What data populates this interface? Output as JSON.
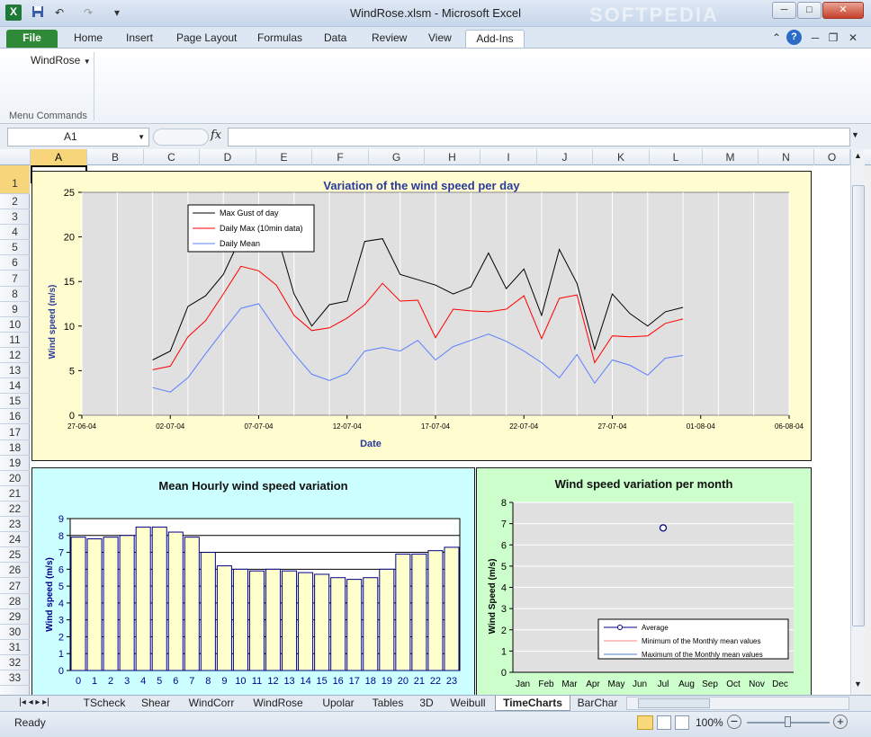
{
  "window": {
    "title": "WindRose.xlsm  -  Microsoft Excel",
    "watermark": "SOFTPEDIA",
    "buttons": {
      "minimize": "─",
      "maximize": "□",
      "close": "✕"
    }
  },
  "ribbon": {
    "tabs": [
      "File",
      "Home",
      "Insert",
      "Page Layout",
      "Formulas",
      "Data",
      "Review",
      "View",
      "Add-Ins"
    ],
    "active_tab": "Add-Ins",
    "windrose_menu": "WindRose",
    "group_label": "Menu Commands"
  },
  "formula_bar": {
    "name_box": "A1",
    "fx": "fx",
    "value": ""
  },
  "columns": [
    "A",
    "B",
    "C",
    "D",
    "E",
    "F",
    "G",
    "H",
    "I",
    "J",
    "K",
    "L",
    "M",
    "N",
    "O"
  ],
  "rows": [
    "1",
    "2",
    "3",
    "4",
    "5",
    "6",
    "7",
    "8",
    "9",
    "10",
    "11",
    "12",
    "13",
    "14",
    "15",
    "16",
    "17",
    "18",
    "19",
    "20",
    "21",
    "22",
    "23",
    "24",
    "25",
    "26",
    "27",
    "28",
    "29",
    "30",
    "31",
    "32",
    "33"
  ],
  "charts": {
    "daily": {
      "title": "Variation of the wind speed per day",
      "xlabel": "Date",
      "ylabel": "Wind speed (m/s)",
      "bg": "#fffdd0"
    },
    "hourly": {
      "title": "Mean Hourly  wind speed variation",
      "ylabel": "Wind speed (m/s)",
      "bg": "#ccffff"
    },
    "monthly": {
      "title": "Wind speed  variation per month",
      "ylabel": "Wind Speed (m/s)",
      "bg": "#ccffcc"
    }
  },
  "chart_data": [
    {
      "type": "line",
      "title": "Variation of the wind speed per day",
      "xlabel": "Date",
      "ylabel": "Wind speed (m/s)",
      "ylim": [
        0,
        25
      ],
      "x_ticks": [
        "27-06-04",
        "02-07-04",
        "07-07-04",
        "12-07-04",
        "17-07-04",
        "22-07-04",
        "27-07-04",
        "01-08-04",
        "06-08-04"
      ],
      "x": [
        "2004-07-01",
        "2004-07-02",
        "2004-07-03",
        "2004-07-04",
        "2004-07-05",
        "2004-07-06",
        "2004-07-07",
        "2004-07-08",
        "2004-07-09",
        "2004-07-10",
        "2004-07-11",
        "2004-07-12",
        "2004-07-13",
        "2004-07-14",
        "2004-07-15",
        "2004-07-16",
        "2004-07-17",
        "2004-07-18",
        "2004-07-19",
        "2004-07-20",
        "2004-07-21",
        "2004-07-22",
        "2004-07-23",
        "2004-07-24",
        "2004-07-25",
        "2004-07-26",
        "2004-07-27",
        "2004-07-28",
        "2004-07-29",
        "2004-07-30",
        "2004-07-31"
      ],
      "series": [
        {
          "name": "Max Gust of day",
          "color": "#000000",
          "values": [
            6.2,
            7.2,
            12.2,
            13.4,
            15.8,
            20,
            20.5,
            20.5,
            13.6,
            10,
            12.4,
            12.8,
            19.5,
            19.8,
            15.8,
            15.2,
            14.6,
            13.6,
            14.4,
            18.2,
            14.2,
            16.4,
            11.2,
            18.6,
            14.8,
            7.4,
            13.6,
            11.4,
            10.0,
            11.6,
            12.1
          ]
        },
        {
          "name": "Daily Max (10min data)",
          "color": "#ff0000",
          "values": [
            5.1,
            5.5,
            8.8,
            10.6,
            13.6,
            16.7,
            16.2,
            14.6,
            11.2,
            9.5,
            9.8,
            10.9,
            12.4,
            14.8,
            12.8,
            12.9,
            8.7,
            11.9,
            11.7,
            11.6,
            11.9,
            13.4,
            8.6,
            13.1,
            13.5,
            5.9,
            8.9,
            8.8,
            8.9,
            10.3,
            10.8
          ]
        },
        {
          "name": "Daily Mean",
          "color": "#5b7fff",
          "values": [
            3.1,
            2.6,
            4.2,
            6.9,
            9.5,
            12.0,
            12.5,
            9.6,
            6.9,
            4.6,
            3.9,
            4.7,
            7.2,
            7.6,
            7.2,
            8.4,
            6.2,
            7.7,
            8.4,
            9.1,
            8.3,
            7.2,
            5.9,
            4.2,
            6.8,
            3.6,
            6.2,
            5.6,
            4.5,
            6.4,
            6.7
          ]
        }
      ]
    },
    {
      "type": "bar",
      "title": "Mean Hourly  wind speed variation",
      "xlabel": "",
      "ylabel": "Wind speed (m/s)",
      "ylim": [
        0,
        9
      ],
      "categories": [
        "0",
        "1",
        "2",
        "3",
        "4",
        "5",
        "6",
        "7",
        "8",
        "9",
        "10",
        "11",
        "12",
        "13",
        "14",
        "15",
        "16",
        "17",
        "18",
        "19",
        "20",
        "21",
        "22",
        "23"
      ],
      "values": [
        7.9,
        7.8,
        7.9,
        8.0,
        8.5,
        8.5,
        8.2,
        7.9,
        7.0,
        6.2,
        6.0,
        5.9,
        6.0,
        5.9,
        5.8,
        5.7,
        5.5,
        5.4,
        5.5,
        6.0,
        6.9,
        6.9,
        7.1,
        7.3
      ]
    },
    {
      "type": "line",
      "title": "Wind speed  variation per month",
      "xlabel": "",
      "ylabel": "Wind Speed (m/s)",
      "ylim": [
        0,
        8
      ],
      "categories": [
        "Jan",
        "Feb",
        "Mar",
        "Apr",
        "May",
        "Jun",
        "Jul",
        "Aug",
        "Sep",
        "Oct",
        "Nov",
        "Dec"
      ],
      "series": [
        {
          "name": "Average",
          "color": "#00008b",
          "values": [
            null,
            null,
            null,
            null,
            null,
            null,
            6.8,
            null,
            null,
            null,
            null,
            null
          ]
        },
        {
          "name": "Minimum of the Monthly mean values",
          "color": "#ff8080",
          "values": []
        },
        {
          "name": "Maximum of the Monthly mean values",
          "color": "#4a7fd4",
          "values": []
        }
      ]
    }
  ],
  "sheet_tabs": [
    "TScheck",
    "Shear",
    "WindCorr",
    "WindRose",
    "Upolar",
    "Tables",
    "3D",
    "Weibull",
    "TimeCharts",
    "BarChar"
  ],
  "active_sheet": "TimeCharts",
  "status": {
    "ready": "Ready",
    "zoom": "100%"
  }
}
